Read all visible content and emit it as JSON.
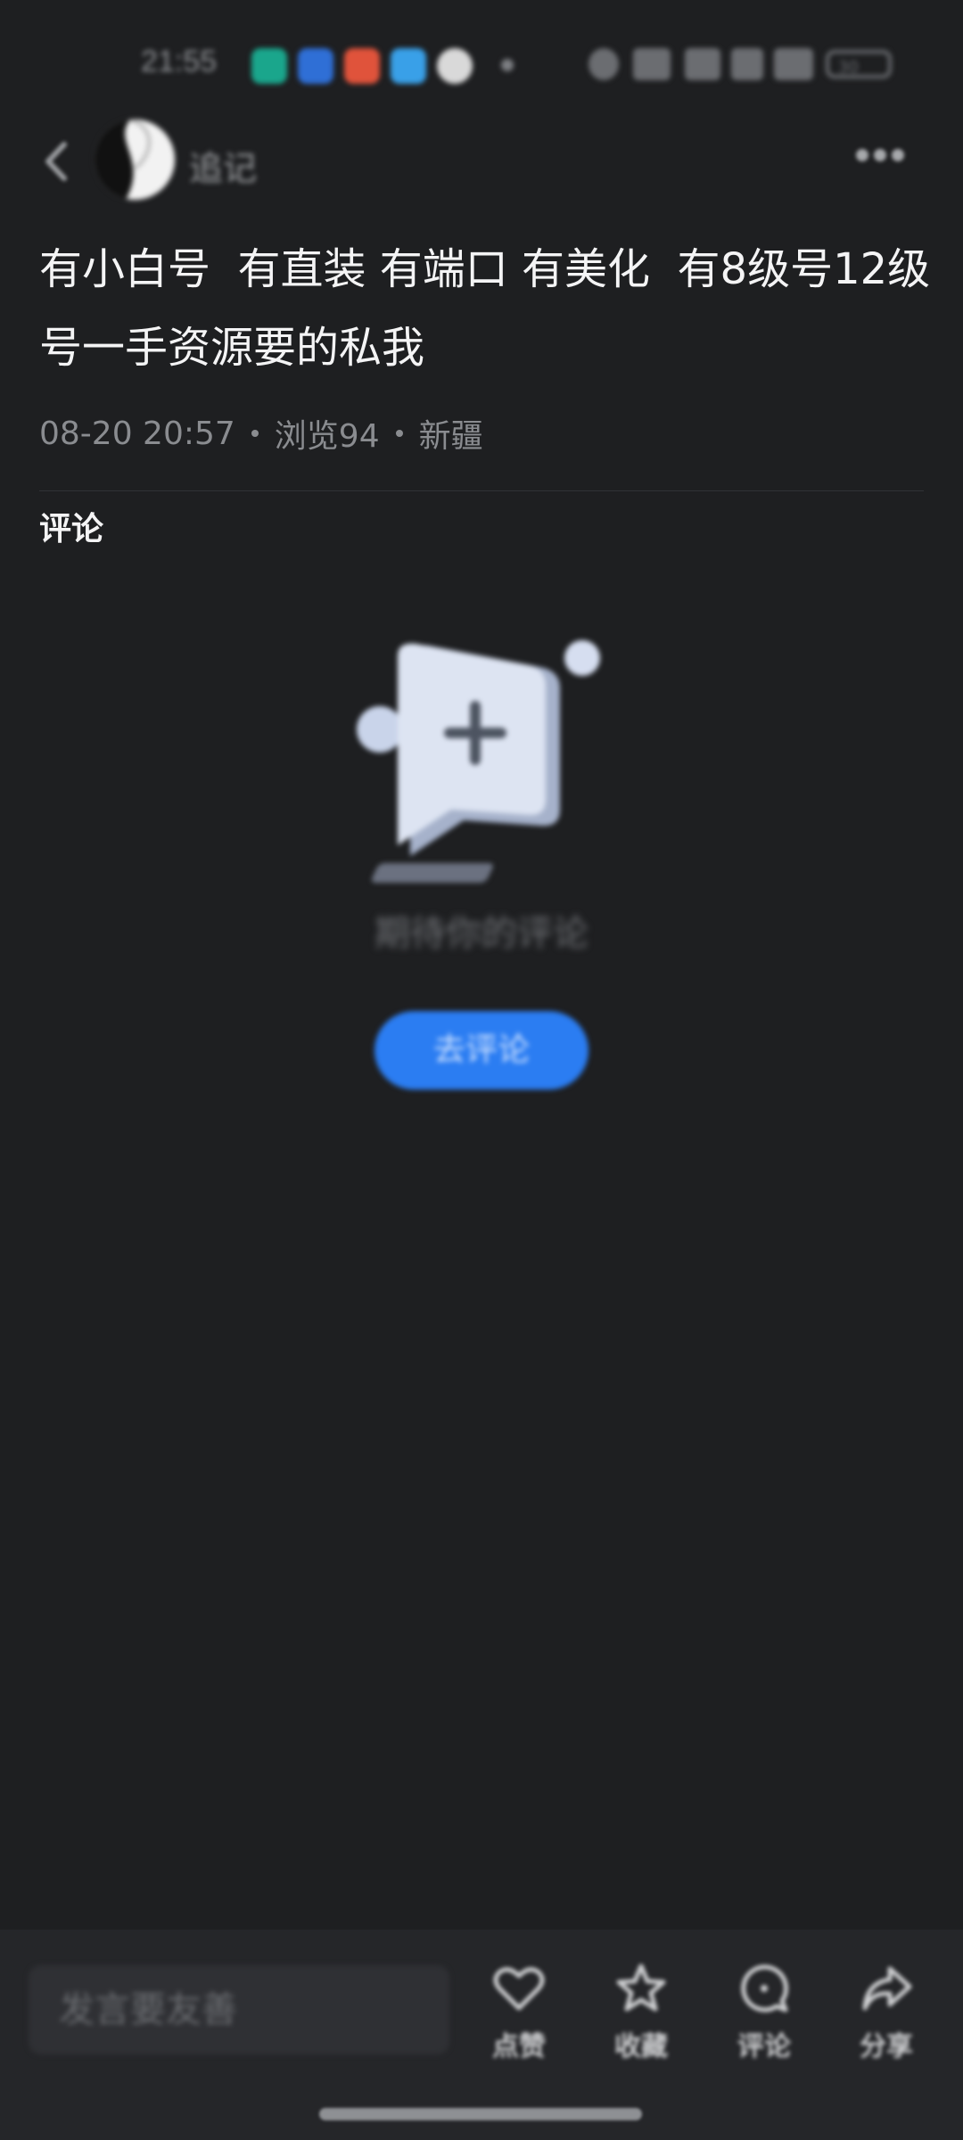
{
  "status_bar": {
    "time": "21:55",
    "app_icons": [
      "app-green-icon",
      "message-icon",
      "photos-icon",
      "browser-icon",
      "wechat-icon"
    ],
    "battery": "30",
    "colors": {
      "app_green": "#1aa68c",
      "message": "#2f6fd6",
      "photos": "#e0533b",
      "browser": "#39a0e8",
      "wechat": "#d9d9d9"
    }
  },
  "nav": {
    "author_name": "追记"
  },
  "post": {
    "title": "有小白号  有直装 有端口 有美化  有8级号12级号一手资源要的私我",
    "date": "08-20 20:57",
    "views": "浏览94",
    "location": "新疆"
  },
  "comments": {
    "heading": "评论",
    "empty_text": "期待你的评论",
    "go_comment_label": "去评论"
  },
  "bottom_bar": {
    "input_placeholder": "发言要友善",
    "like_label": "点赞",
    "favorite_label": "收藏",
    "comment_label": "评论",
    "share_label": "分享"
  },
  "colors": {
    "background": "#1e1f21",
    "accent": "#2b7df2",
    "text_primary": "#f4f4f5",
    "text_secondary": "#8a8c90"
  }
}
